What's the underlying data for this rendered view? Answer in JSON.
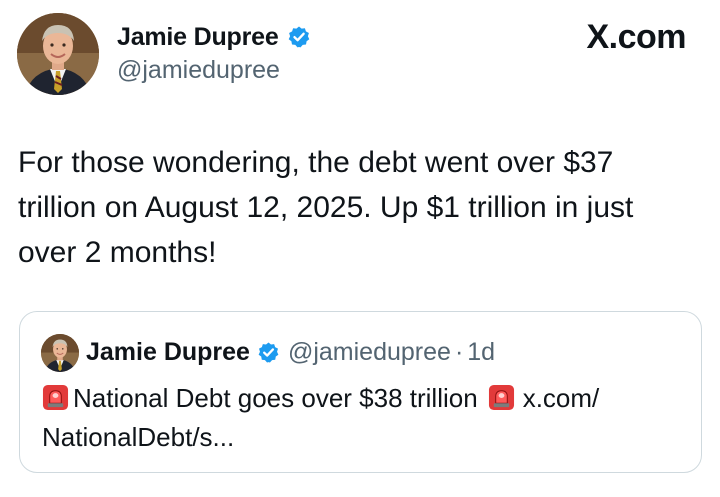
{
  "site": {
    "label": "X.com"
  },
  "author": {
    "name": "Jamie Dupree",
    "handle": "@jamiedupree",
    "verified": true
  },
  "tweet": {
    "text_line1": "For those wondering, the debt went over $37",
    "text_line2": "trillion on August 12, 2025.  Up $1 trillion in just",
    "text_line3": "over 2 months!"
  },
  "quoted_tweet": {
    "name": "Jamie Dupree",
    "handle": "@jamiedupree",
    "separator": "·",
    "time": "1d",
    "text_main": "National Debt goes over $38 trillion",
    "link_part1": "x.com/",
    "link_part2": "NationalDebt/s...",
    "emoji": "rotating-light"
  },
  "colors": {
    "text": "#0f1419",
    "secondary_text": "#536471",
    "verified_badge": "#1d9bf0",
    "card_border": "#cfd9de"
  }
}
